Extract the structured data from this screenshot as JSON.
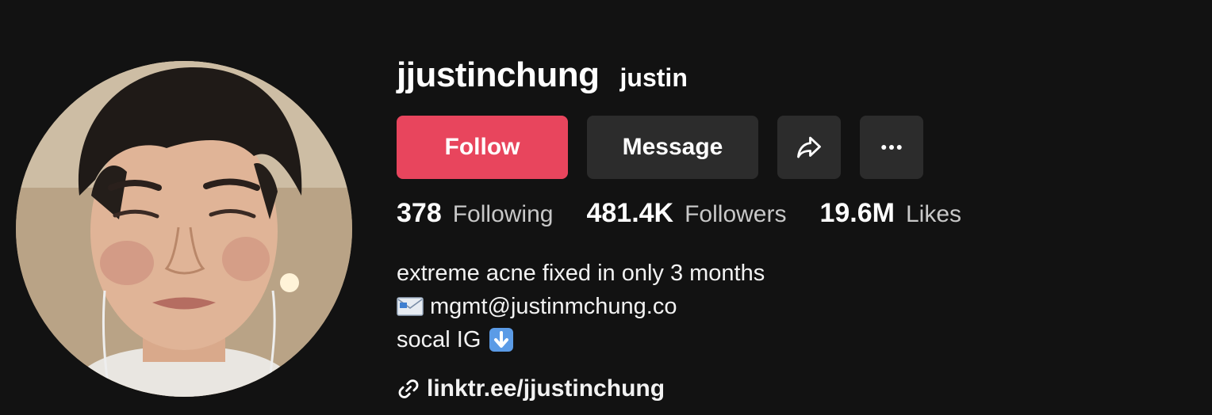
{
  "profile": {
    "username": "jjustinchung",
    "nickname": "justin"
  },
  "actions": {
    "follow_label": "Follow",
    "message_label": "Message",
    "share_icon": "share-arrow-icon",
    "more_icon": "more-dots-icon"
  },
  "stats": {
    "following": {
      "count": "378",
      "label": "Following"
    },
    "followers": {
      "count": "481.4K",
      "label": "Followers"
    },
    "likes": {
      "count": "19.6M",
      "label": "Likes"
    }
  },
  "bio": {
    "line1": "extreme acne fixed in only 3 months",
    "line2": "mgmt@justinmchung.co",
    "line3": "socal IG"
  },
  "link": {
    "text": "linktr.ee/jjustinchung"
  },
  "colors": {
    "background": "#121212",
    "follow_button": "#e8455d",
    "secondary_button": "#2c2c2c"
  }
}
